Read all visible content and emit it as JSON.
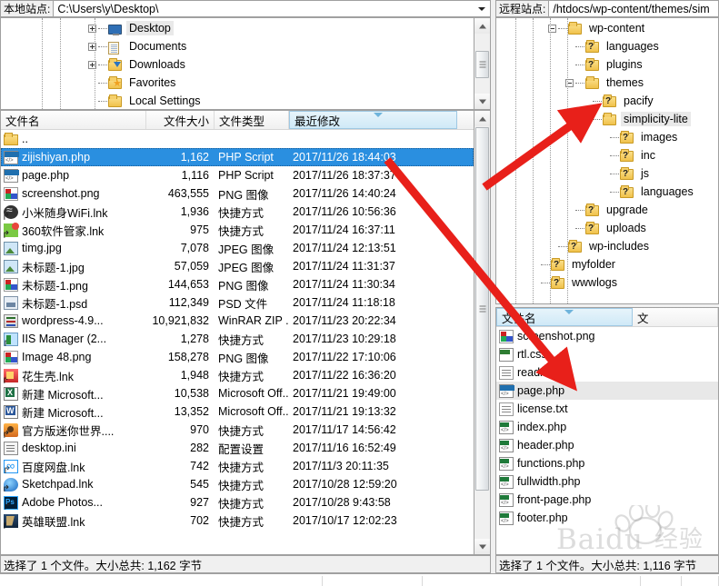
{
  "local": {
    "path_label": "本地站点:",
    "path_value": "C:\\Users\\y\\Desktop\\",
    "tree": [
      {
        "label": "Desktop",
        "icon": "monitor-icon",
        "indent": 0,
        "expander": "plus",
        "selected": true
      },
      {
        "label": "Documents",
        "icon": "documents-icon",
        "indent": 0,
        "expander": "plus",
        "selected": false
      },
      {
        "label": "Downloads",
        "icon": "downloads-icon",
        "indent": 0,
        "expander": "plus",
        "selected": false
      },
      {
        "label": "Favorites",
        "icon": "favorites-icon",
        "indent": 0,
        "expander": "none",
        "selected": false
      },
      {
        "label": "Local Settings",
        "icon": "folder-icon",
        "indent": 0,
        "expander": "none",
        "selected": false
      }
    ],
    "columns": [
      "文件名",
      "文件大小",
      "文件类型",
      "最近修改"
    ],
    "sorted_column": "最近修改",
    "files": [
      {
        "name": "..",
        "size": "",
        "type": "",
        "date": "",
        "icon": "folder-icon",
        "selected": false
      },
      {
        "name": "zijishiyan.php",
        "size": "1,162",
        "type": "PHP Script",
        "date": "2017/11/26 18:44:03",
        "icon": "php-file-icon",
        "selected": true
      },
      {
        "name": "page.php",
        "size": "1,116",
        "type": "PHP Script",
        "date": "2017/11/26 18:37:37",
        "icon": "php-file-icon",
        "selected": false
      },
      {
        "name": "screenshot.png",
        "size": "463,555",
        "type": "PNG 图像",
        "date": "2017/11/26 14:40:24",
        "icon": "png-file-icon",
        "selected": false
      },
      {
        "name": "小米随身WiFi.lnk",
        "size": "1,936",
        "type": "快捷方式",
        "date": "2017/11/26 10:56:36",
        "icon": "wifi-shortcut-icon",
        "selected": false
      },
      {
        "name": "360软件管家.lnk",
        "size": "975",
        "type": "快捷方式",
        "date": "2017/11/24 16:37:11",
        "icon": "360-shortcut-icon",
        "selected": false
      },
      {
        "name": "timg.jpg",
        "size": "7,078",
        "type": "JPEG 图像",
        "date": "2017/11/24 12:13:51",
        "icon": "jpg-file-icon",
        "selected": false
      },
      {
        "name": "未标题-1.jpg",
        "size": "57,059",
        "type": "JPEG 图像",
        "date": "2017/11/24 11:31:37",
        "icon": "jpg-file-icon",
        "selected": false
      },
      {
        "name": "未标题-1.png",
        "size": "144,653",
        "type": "PNG 图像",
        "date": "2017/11/24 11:30:34",
        "icon": "png-file-icon",
        "selected": false
      },
      {
        "name": "未标题-1.psd",
        "size": "112,349",
        "type": "PSD 文件",
        "date": "2017/11/24 11:18:18",
        "icon": "psd-file-icon",
        "selected": false
      },
      {
        "name": "wordpress-4.9...",
        "size": "10,921,832",
        "type": "WinRAR ZIP ...",
        "date": "2017/11/23 20:22:34",
        "icon": "zip-file-icon",
        "selected": false
      },
      {
        "name": "IIS Manager (2...",
        "size": "1,278",
        "type": "快捷方式",
        "date": "2017/11/23 10:29:18",
        "icon": "iis-shortcut-icon",
        "selected": false
      },
      {
        "name": "Image 48.png",
        "size": "158,278",
        "type": "PNG 图像",
        "date": "2017/11/22 17:10:06",
        "icon": "png-file-icon",
        "selected": false
      },
      {
        "name": "花生壳.lnk",
        "size": "1,948",
        "type": "快捷方式",
        "date": "2017/11/22 16:36:20",
        "icon": "hsk-shortcut-icon",
        "selected": false
      },
      {
        "name": "新建 Microsoft...",
        "size": "10,538",
        "type": "Microsoft Off...",
        "date": "2017/11/21 19:49:00",
        "icon": "excel-file-icon",
        "selected": false
      },
      {
        "name": "新建 Microsoft...",
        "size": "13,352",
        "type": "Microsoft Off...",
        "date": "2017/11/21 19:13:32",
        "icon": "word-file-icon",
        "selected": false
      },
      {
        "name": "官方版迷你世界....",
        "size": "970",
        "type": "快捷方式",
        "date": "2017/11/17 14:56:42",
        "icon": "mini-shortcut-icon",
        "selected": false
      },
      {
        "name": "desktop.ini",
        "size": "282",
        "type": "配置设置",
        "date": "2017/11/16 16:52:49",
        "icon": "ini-file-icon",
        "selected": false
      },
      {
        "name": "百度网盘.lnk",
        "size": "742",
        "type": "快捷方式",
        "date": "2017/11/3 20:11:35",
        "icon": "baidu-shortcut-icon",
        "selected": false
      },
      {
        "name": "Sketchpad.lnk",
        "size": "545",
        "type": "快捷方式",
        "date": "2017/10/28 12:59:20",
        "icon": "sketchpad-shortcut-icon",
        "selected": false
      },
      {
        "name": "Adobe Photos...",
        "size": "927",
        "type": "快捷方式",
        "date": "2017/10/28 9:43:58",
        "icon": "photoshop-shortcut-icon",
        "selected": false
      },
      {
        "name": "英雄联盟.lnk",
        "size": "702",
        "type": "快捷方式",
        "date": "2017/10/17 12:02:23",
        "icon": "lol-shortcut-icon",
        "selected": false
      }
    ],
    "status": "选择了 1 个文件。大小总共: 1,162 字节"
  },
  "remote": {
    "path_label": "远程站点:",
    "path_value": "/htdocs/wp-content/themes/sim",
    "tree": [
      {
        "label": "wp-content",
        "icon": "folder-icon",
        "indent": 1,
        "expander": "minus",
        "selected": false
      },
      {
        "label": "languages",
        "icon": "folder-unknown-icon",
        "indent": 2,
        "expander": "none",
        "selected": false
      },
      {
        "label": "plugins",
        "icon": "folder-unknown-icon",
        "indent": 2,
        "expander": "none",
        "selected": false
      },
      {
        "label": "themes",
        "icon": "folder-icon",
        "indent": 2,
        "expander": "minus",
        "selected": false
      },
      {
        "label": "pacify",
        "icon": "folder-unknown-icon",
        "indent": 3,
        "expander": "none",
        "selected": false
      },
      {
        "label": "simplicity-lite",
        "icon": "folder-icon",
        "indent": 3,
        "expander": "minus",
        "selected": true
      },
      {
        "label": "images",
        "icon": "folder-unknown-icon",
        "indent": 4,
        "expander": "none",
        "selected": false
      },
      {
        "label": "inc",
        "icon": "folder-unknown-icon",
        "indent": 4,
        "expander": "none",
        "selected": false
      },
      {
        "label": "js",
        "icon": "folder-unknown-icon",
        "indent": 4,
        "expander": "none",
        "selected": false
      },
      {
        "label": "languages",
        "icon": "folder-unknown-icon",
        "indent": 4,
        "expander": "none",
        "selected": false
      },
      {
        "label": "upgrade",
        "icon": "folder-unknown-icon",
        "indent": 2,
        "expander": "none",
        "selected": false
      },
      {
        "label": "uploads",
        "icon": "folder-unknown-icon",
        "indent": 2,
        "expander": "none",
        "selected": false
      },
      {
        "label": "wp-includes",
        "icon": "folder-unknown-icon",
        "indent": 1,
        "expander": "none",
        "selected": false
      },
      {
        "label": "myfolder",
        "icon": "folder-unknown-icon",
        "indent": 0,
        "expander": "none",
        "selected": false
      },
      {
        "label": "wwwlogs",
        "icon": "folder-unknown-icon",
        "indent": 0,
        "expander": "none",
        "selected": false
      }
    ],
    "columns": [
      "文件名",
      "文"
    ],
    "sorted_column": "文件名",
    "files": [
      {
        "name": "screenshot.png",
        "icon": "png-file-icon",
        "selected": false
      },
      {
        "name": "rtl.css",
        "icon": "css-file-icon",
        "selected": false
      },
      {
        "name": "readme.txt",
        "icon": "txt-file-icon",
        "selected": false
      },
      {
        "name": "page.php",
        "icon": "php-file-icon",
        "selected": true
      },
      {
        "name": "license.txt",
        "icon": "txt-file-icon",
        "selected": false
      },
      {
        "name": "index.php",
        "icon": "php-web-icon",
        "selected": false
      },
      {
        "name": "header.php",
        "icon": "php-web-icon",
        "selected": false
      },
      {
        "name": "functions.php",
        "icon": "php-web-icon",
        "selected": false
      },
      {
        "name": "fullwidth.php",
        "icon": "php-web-icon",
        "selected": false
      },
      {
        "name": "front-page.php",
        "icon": "php-web-icon",
        "selected": false
      },
      {
        "name": "footer.php",
        "icon": "php-web-icon",
        "selected": false
      }
    ],
    "status": "选择了 1 个文件。大小总共: 1,116 字节"
  },
  "annotations": {
    "arrow_color": "#e8201a",
    "arrow_to_simplicity": "arrow pointing to simplicity-lite folder",
    "arrow_to_readme": "arrow pointing to readme.txt"
  },
  "watermark": {
    "text": "Baidu 经验"
  }
}
